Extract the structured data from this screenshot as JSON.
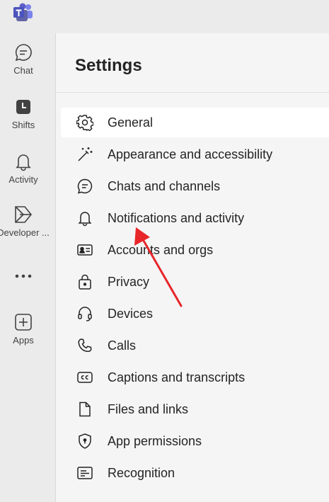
{
  "colors": {
    "teams_purple": "#5b5fc7",
    "arrow_red": "#e8262a",
    "selected_bg": "#ffffff",
    "content_bg": "#f5f5f5",
    "rail_bg": "#ebebeb"
  },
  "app": {
    "logo_icon": "teams-logo"
  },
  "rail": {
    "items": [
      {
        "label": "Chat",
        "icon": "chat-icon"
      },
      {
        "label": "Shifts",
        "icon": "shifts-icon"
      },
      {
        "label": "Activity",
        "icon": "bell-icon"
      },
      {
        "label": "Developer ...",
        "icon": "developer-portal-icon"
      },
      {
        "label": "",
        "icon": "more-icon"
      },
      {
        "label": "Apps",
        "icon": "apps-add-icon"
      }
    ]
  },
  "settings": {
    "title": "Settings",
    "menu": [
      {
        "label": "General",
        "icon": "gear-icon",
        "selected": true
      },
      {
        "label": "Appearance and accessibility",
        "icon": "magic-wand-icon"
      },
      {
        "label": "Chats and channels",
        "icon": "chat-bubble-icon"
      },
      {
        "label": "Notifications and activity",
        "icon": "bell-icon"
      },
      {
        "label": "Accounts and orgs",
        "icon": "id-card-icon"
      },
      {
        "label": "Privacy",
        "icon": "lock-icon"
      },
      {
        "label": "Devices",
        "icon": "headset-icon"
      },
      {
        "label": "Calls",
        "icon": "phone-icon"
      },
      {
        "label": "Captions and transcripts",
        "icon": "closed-captions-icon"
      },
      {
        "label": "Files and links",
        "icon": "file-icon"
      },
      {
        "label": "App permissions",
        "icon": "shield-icon"
      },
      {
        "label": "Recognition",
        "icon": "recognition-icon"
      }
    ]
  },
  "annotation": {
    "type": "red-arrow",
    "points_to": "Notifications and activity"
  }
}
